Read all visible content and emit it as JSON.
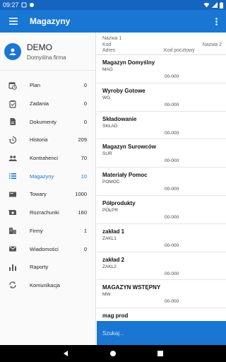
{
  "status_bar": {
    "time": "09:27"
  },
  "app_bar": {
    "title": "Magazyny"
  },
  "profile": {
    "name": "DEMO",
    "company": "Domyślna firma"
  },
  "nav": [
    {
      "label": "Plan",
      "count": "0",
      "icon": "calendar-clock-icon"
    },
    {
      "label": "Zadania",
      "count": "0",
      "icon": "clipboard-check-icon"
    },
    {
      "label": "Dokumenty",
      "count": "0",
      "icon": "document-icon"
    },
    {
      "label": "Historia",
      "count": "209",
      "icon": "history-icon"
    },
    {
      "label": "Kontrahenci",
      "count": "70",
      "icon": "people-icon"
    },
    {
      "label": "Magazyny",
      "count": "10",
      "icon": "list-icon",
      "active": true
    },
    {
      "label": "Towary",
      "count": "1000",
      "icon": "product-icon"
    },
    {
      "label": "Rozrachunki",
      "count": "160",
      "icon": "money-icon"
    },
    {
      "label": "Firmy",
      "count": "1",
      "icon": "building-icon"
    },
    {
      "label": "Wiadomości",
      "count": "0",
      "icon": "mail-icon"
    },
    {
      "label": "Raporty",
      "count": "",
      "icon": "bar-chart-icon"
    },
    {
      "label": "Komunikacja",
      "count": "",
      "icon": "sync-icon"
    }
  ],
  "columns": {
    "name1": "Nazwa 1",
    "name2": "Nazwa 2",
    "code": "Kod",
    "address": "Adres",
    "postal_code": "Kod pocztowy"
  },
  "warehouses": [
    {
      "name": "Magazyn Domyślny",
      "code": "MAG",
      "postal": "00-000"
    },
    {
      "name": "Wyroby Gotowe",
      "code": "WG",
      "postal": "00-000"
    },
    {
      "name": "Składowanie",
      "code": "SKŁAD",
      "postal": "00-000"
    },
    {
      "name": "Magazyn Surowców",
      "code": "SUR",
      "postal": "00-000"
    },
    {
      "name": "Materiały Pomoc",
      "code": "POMOC",
      "postal": "00-000"
    },
    {
      "name": "Półprodukty",
      "code": "PÓŁPR",
      "postal": "00-000"
    },
    {
      "name": "zakład 1",
      "code": "ZAKL1",
      "postal": "00-000"
    },
    {
      "name": "zakład 2",
      "code": "ZAKL2",
      "postal": "00-000"
    },
    {
      "name": "MAGAZYN WSTĘPNY",
      "code": "MW",
      "postal": "00-000"
    },
    {
      "name": "mag prod",
      "code": "",
      "postal": ""
    }
  ],
  "search": {
    "placeholder": "Szukaj..."
  },
  "colors": {
    "primary": "#1976d2",
    "primary_dark": "#1565c0",
    "active": "#1976d2"
  }
}
